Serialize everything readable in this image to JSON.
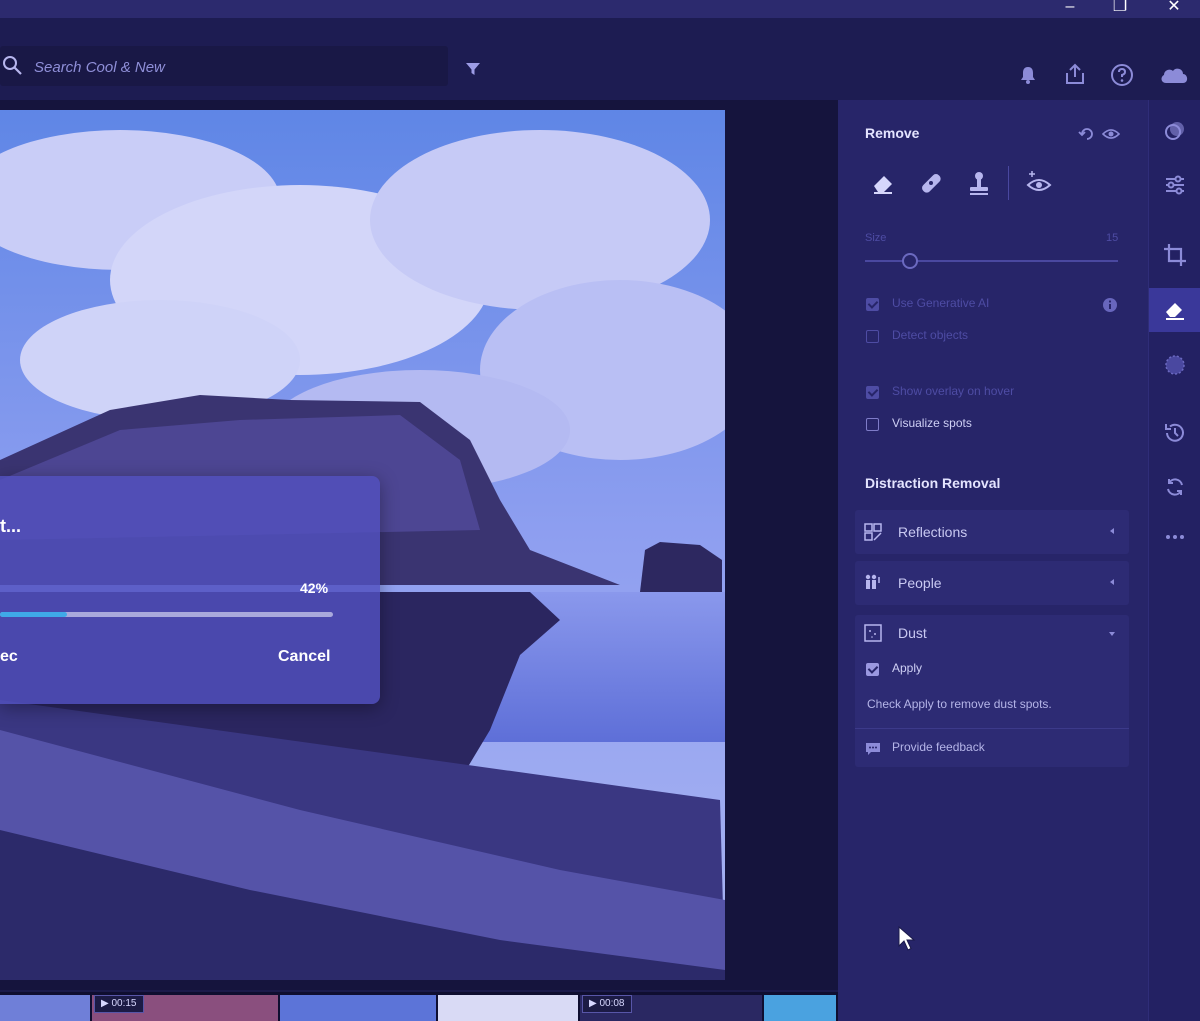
{
  "window": {
    "controls": {
      "minimize": "–",
      "restore": "❐",
      "close": "✕"
    }
  },
  "search": {
    "placeholder": "Search Cool & New",
    "filter_icon": "filter-icon"
  },
  "topbar_icons": [
    "bell-icon",
    "share-icon",
    "help-icon",
    "cloud-icon"
  ],
  "dialog": {
    "title": "t...",
    "percent_label": "42%",
    "progress": 0.2,
    "left_button": "ec",
    "cancel_label": "Cancel"
  },
  "filmstrip": {
    "durations": [
      "00:15",
      "00:08"
    ]
  },
  "remove_panel": {
    "title": "Remove",
    "tools": [
      "eraser-icon",
      "heal-icon",
      "clone-stamp-icon",
      "reveal-icon"
    ],
    "size": {
      "label": "Size",
      "value": "15",
      "level": 0.17
    },
    "options": {
      "use_generative_ai": {
        "label": "Use Generative AI",
        "checked": true
      },
      "detect_objects": {
        "label": "Detect objects",
        "checked": false
      },
      "show_overlay": {
        "label": "Show overlay on hover",
        "checked": true
      },
      "visualize_spots": {
        "label": "Visualize spots",
        "checked": false
      }
    }
  },
  "distraction_removal": {
    "title": "Distraction Removal",
    "items": [
      {
        "label": "Reflections",
        "icon": "reflections-icon",
        "expanded": false
      },
      {
        "label": "People",
        "icon": "people-icon",
        "expanded": false
      },
      {
        "label": "Dust",
        "icon": "dust-icon",
        "expanded": true
      }
    ],
    "dust": {
      "apply_label": "Apply",
      "apply_checked": true,
      "note": "Check Apply to remove dust spots."
    },
    "feedback_label": "Provide feedback"
  },
  "sidebar_icons": [
    "edit-icon",
    "adjust-sliders-icon",
    "crop-icon",
    "remove-tool-icon",
    "masking-icon",
    "history-icon",
    "versions-icon",
    "more-icon"
  ],
  "colors": {
    "background": "#1b1a4a",
    "panel": "#272569",
    "accent": "#3fa9e8",
    "dialog": "#5250be"
  }
}
